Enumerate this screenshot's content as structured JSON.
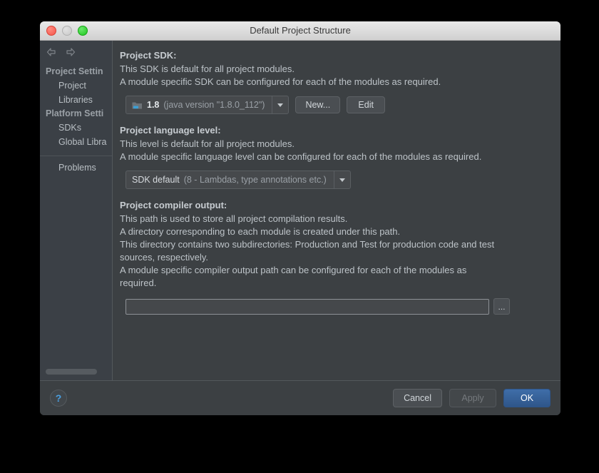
{
  "window": {
    "title": "Default Project Structure",
    "traffic_lights": [
      "close-button",
      "minimize-button",
      "maximize-button"
    ]
  },
  "sidebar": {
    "nav": {
      "back_icon": "arrow-left-icon",
      "forward_icon": "arrow-right-icon"
    },
    "groups": [
      {
        "label": "Project Settin",
        "items": [
          {
            "label": "Project"
          },
          {
            "label": "Libraries"
          }
        ]
      },
      {
        "label": "Platform Setti",
        "items": [
          {
            "label": "SDKs"
          },
          {
            "label": "Global Libra"
          }
        ]
      }
    ],
    "extra_items": [
      {
        "label": "Problems"
      }
    ]
  },
  "content": {
    "project_sdk": {
      "title": "Project SDK:",
      "line1": "This SDK is default for all project modules.",
      "line2": "A module specific SDK can be configured for each of the modules as required.",
      "combo": {
        "icon": "jdk-folder-icon",
        "name": "1.8",
        "version": "(java version \"1.8.0_112\")",
        "arrow_icon": "chevron-down-icon"
      },
      "new_button": "New...",
      "edit_button": "Edit"
    },
    "language_level": {
      "title": "Project language level:",
      "line1": "This level is default for all project modules.",
      "line2": "A module specific language level can be configured for each of the modules as required.",
      "combo": {
        "name": "SDK default",
        "description": "(8 - Lambdas, type annotations etc.)",
        "arrow_icon": "chevron-down-icon"
      }
    },
    "compiler_output": {
      "title": "Project compiler output:",
      "line1": "This path is used to store all project compilation results.",
      "line2": "A directory corresponding to each module is created under this path.",
      "line3": "This directory contains two subdirectories: Production and Test for production code and test sources, respectively.",
      "line4": "A module specific compiler output path can be configured for each of the modules as required.",
      "path_value": "",
      "path_placeholder": "",
      "browse_button": "..."
    }
  },
  "footer": {
    "help_label": "?",
    "cancel_label": "Cancel",
    "apply_label": "Apply",
    "ok_label": "OK"
  },
  "colors": {
    "window_bg": "#3c4043",
    "sidebar_bg": "#3b4046",
    "titlebar_bg": "#dedede",
    "accent_blue": "#3f6ea8",
    "help_blue": "#4a9fe0",
    "text_primary": "#bdc3c8",
    "text_muted": "#9aa0a6"
  }
}
